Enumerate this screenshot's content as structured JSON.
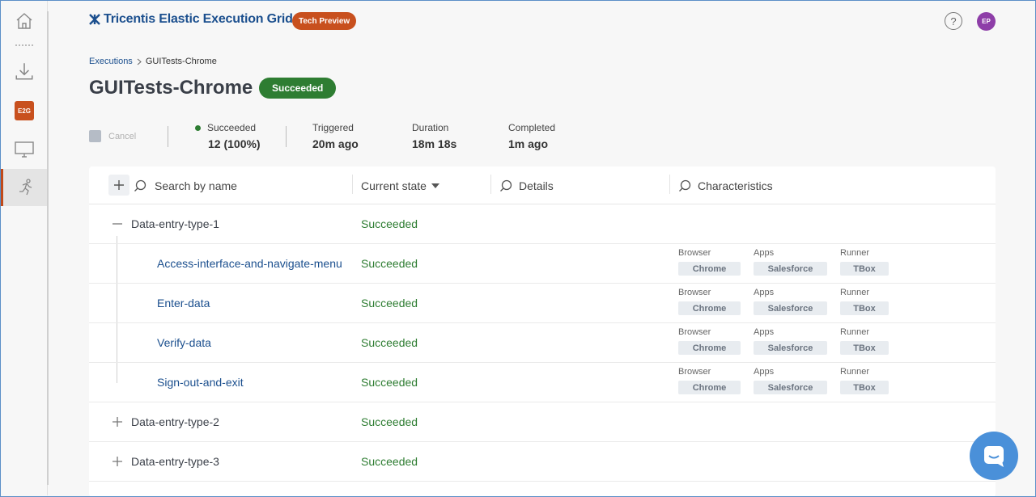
{
  "header": {
    "logo_text": "Tricentis Elastic Execution Grid",
    "badge": "Tech Preview",
    "help_symbol": "?",
    "avatar_initials": "EP"
  },
  "rail": {
    "e2g_label": "E2G",
    "icons": [
      "home-icon",
      "download-icon",
      "e2g-icon",
      "monitor-icon",
      "runner-icon"
    ],
    "active_accent": "#c04a1a"
  },
  "breadcrumb": {
    "parent": "Executions",
    "separator": ">",
    "current": "GUITests-Chrome"
  },
  "page": {
    "title": "GUITests-Chrome",
    "status": "Succeeded"
  },
  "summary": {
    "cancel_label": "Cancel",
    "succeeded_label": "Succeeded",
    "succeeded_value": "12 (100%)",
    "triggered_label": "Triggered",
    "triggered_value": "20m ago",
    "duration_label": "Duration",
    "duration_value": "18m 18s",
    "completed_label": "Completed",
    "completed_value": "1m ago"
  },
  "table": {
    "search_placeholder": "Search by name",
    "col_state": "Current state",
    "col_details": "Details",
    "col_characteristics": "Characteristics",
    "rows": [
      {
        "kind": "group",
        "name": "Data-entry-type-1",
        "state": "Succeeded",
        "expanded": true
      },
      {
        "kind": "test",
        "name": "Access-interface-and-navigate-menu",
        "state": "Succeeded",
        "browser": "Chrome",
        "apps": "Salesforce",
        "runner": "TBox"
      },
      {
        "kind": "test",
        "name": "Enter-data",
        "state": "Succeeded",
        "browser": "Chrome",
        "apps": "Salesforce",
        "runner": "TBox"
      },
      {
        "kind": "test",
        "name": "Verify-data",
        "state": "Succeeded",
        "browser": "Chrome",
        "apps": "Salesforce",
        "runner": "TBox"
      },
      {
        "kind": "test",
        "name": "Sign-out-and-exit",
        "state": "Succeeded",
        "browser": "Chrome",
        "apps": "Salesforce",
        "runner": "TBox"
      },
      {
        "kind": "group",
        "name": "Data-entry-type-2",
        "state": "Succeeded",
        "expanded": false
      },
      {
        "kind": "group",
        "name": "Data-entry-type-3",
        "state": "Succeeded",
        "expanded": false
      }
    ],
    "char_keys": {
      "browser": "Browser",
      "apps": "Apps",
      "runner": "Runner"
    }
  },
  "colors": {
    "brand_blue": "#1b4f8e",
    "accent_orange": "#c8501e",
    "success_green": "#2e7d32",
    "chat_blue": "#4a90d9"
  }
}
